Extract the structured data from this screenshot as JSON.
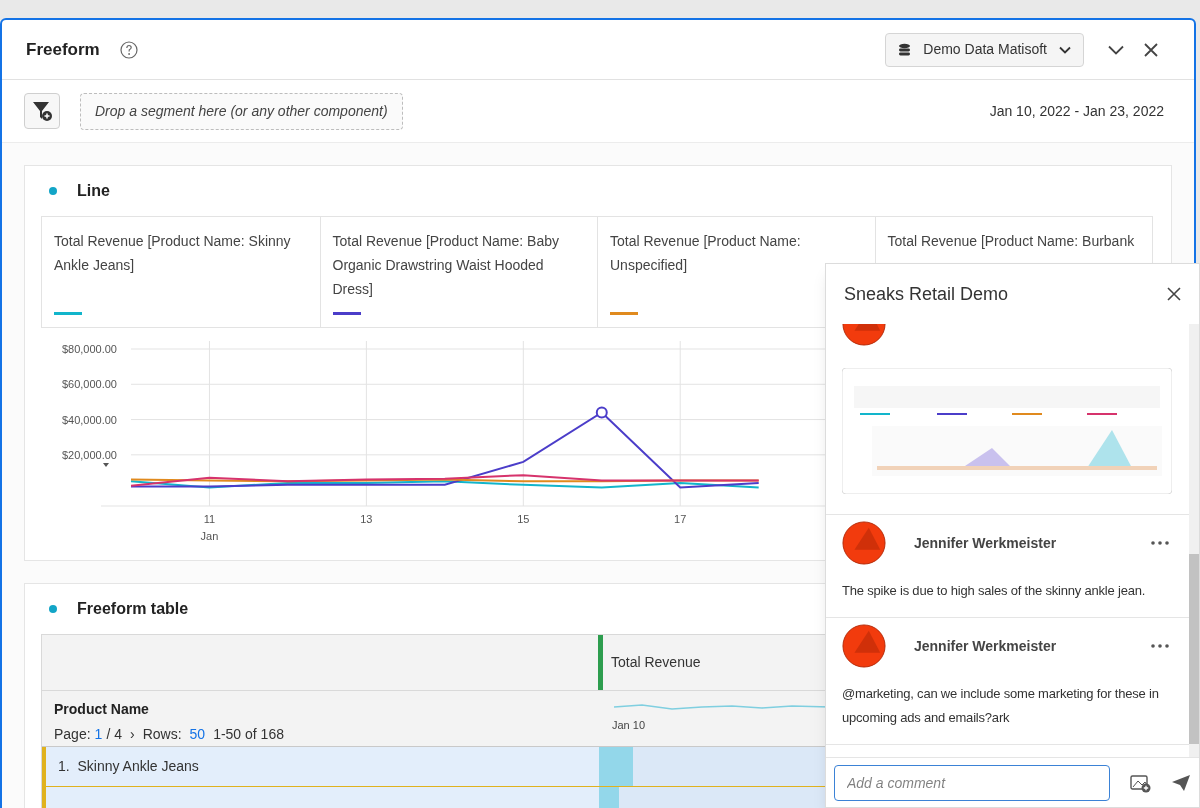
{
  "panel": {
    "title": "Freeform",
    "data_source": "Demo Data Matisoft"
  },
  "toolbar": {
    "drop_zone": "Drop a segment here (or any other component)",
    "date_range": "Jan 10, 2022 - Jan 23, 2022"
  },
  "line_card": {
    "title": "Line",
    "chart_data": {
      "type": "line",
      "x": [
        10,
        11,
        12,
        13,
        14,
        15,
        16,
        17,
        18
      ],
      "xlim": [
        10,
        23
      ],
      "ylim": [
        -9000,
        80000
      ],
      "xticks": [
        {
          "value": 11,
          "label": "11"
        },
        {
          "value": 13,
          "label": "13"
        },
        {
          "value": 15,
          "label": "15"
        },
        {
          "value": 17,
          "label": "17"
        }
      ],
      "xlabel": "Jan",
      "yticks": [
        {
          "value": 20000,
          "label": "$20,000.00"
        },
        {
          "value": 40000,
          "label": "$40,000.00"
        },
        {
          "value": 60000,
          "label": "$60,000.00"
        },
        {
          "value": 80000,
          "label": "$80,000.00"
        }
      ],
      "grid": true,
      "series": [
        {
          "name": "Total Revenue [Product Name: Skinny Ankle Jeans]",
          "color": "#12b5cb",
          "values": [
            5000,
            1500,
            4000,
            4000,
            5000,
            3000,
            1500,
            4000,
            1500
          ]
        },
        {
          "name": "Total Revenue [Product Name: Baby Organic Drawstring Waist Hooded Dress]",
          "color": "#4b3dc9",
          "values": [
            2000,
            2000,
            3000,
            3000,
            3000,
            16000,
            44000,
            1500,
            4000
          ]
        },
        {
          "name": "Total Revenue [Product Name: Unspecified]",
          "color": "#e08a1e",
          "values": [
            6000,
            5500,
            5000,
            5500,
            6000,
            5000,
            5000,
            5500,
            5500
          ]
        },
        {
          "name": "Total Revenue [Product Name: Burbank",
          "color": "#d6336c",
          "values": [
            2500,
            7000,
            5000,
            6000,
            6500,
            8500,
            5500,
            5500,
            5500
          ]
        }
      ]
    }
  },
  "table_card": {
    "title": "Freeform table",
    "metric_column": "Total Revenue",
    "dimension": "Product Name",
    "page_label": "Page:",
    "page": "1",
    "page_total": "/ 4",
    "next": "›",
    "rows_label": "Rows:",
    "rows_value": "50",
    "range": "1-50 of 168",
    "sparkline_start": "Jan 10",
    "rows": [
      {
        "number": "1.",
        "name": "Skinny Ankle Jeans",
        "level": 0.15
      },
      {
        "level": 0.09
      }
    ]
  },
  "comments_panel": {
    "title": "Sneaks Retail Demo",
    "comments": [
      {
        "kind": "picture"
      },
      {
        "author": "Jennifer Werkmeister",
        "kind": "text",
        "text": "The spike is due to high sales of the skinny ankle jean."
      },
      {
        "author": "Jennifer Werkmeister",
        "kind": "text",
        "text": "@marketing, can we include some marketing for these in upcoming ads and emails?ark"
      }
    ],
    "input_placeholder": "Add a comment"
  }
}
